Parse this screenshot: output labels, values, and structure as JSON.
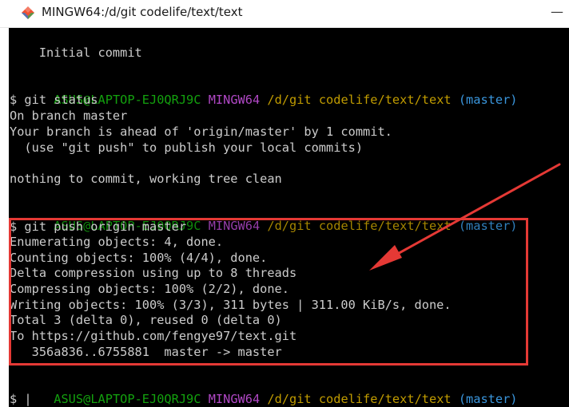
{
  "window": {
    "title": "MINGW64:/d/git codelife/text/text",
    "minimize_glyph": "—",
    "app_icon": "git-diamond-icon"
  },
  "colors": {
    "user_host": "#13a10e",
    "shell": "#b148c6",
    "path": "#c19c00",
    "branch": "#3a96dd",
    "text": "#cccccc",
    "highlight": "#e53935"
  },
  "terminal": {
    "line0": "    Initial commit",
    "prompt1": {
      "user_host": "ASUS@LAPTOP-EJ0QRJ9C",
      "shell": "MINGW64",
      "path": "/d/git codelife/text/text",
      "branch": "(master)"
    },
    "cmd1": "$ git status",
    "out1": [
      "On branch master",
      "Your branch is ahead of 'origin/master' by 1 commit.",
      "  (use \"git push\" to publish your local commits)",
      "",
      "nothing to commit, working tree clean"
    ],
    "prompt2": {
      "user_host": "ASUS@LAPTOP-EJ0QRJ9C",
      "shell": "MINGW64",
      "path": "/d/git codelife/text/text",
      "branch": "(master)"
    },
    "cmd2": "$ git push origin master",
    "out2": [
      "Enumerating objects: 4, done.",
      "Counting objects: 100% (4/4), done.",
      "Delta compression using up to 8 threads",
      "Compressing objects: 100% (2/2), done.",
      "Writing objects: 100% (3/3), 311 bytes | 311.00 KiB/s, done.",
      "Total 3 (delta 0), reused 0 (delta 0)",
      "To https://github.com/fengye97/text.git",
      "   356a836..6755881  master -> master"
    ],
    "prompt3": {
      "user_host": "ASUS@LAPTOP-EJ0QRJ9C",
      "shell": "MINGW64",
      "path": "/d/git codelife/text/text",
      "branch": "(master)"
    },
    "cmd3": "$ |"
  }
}
